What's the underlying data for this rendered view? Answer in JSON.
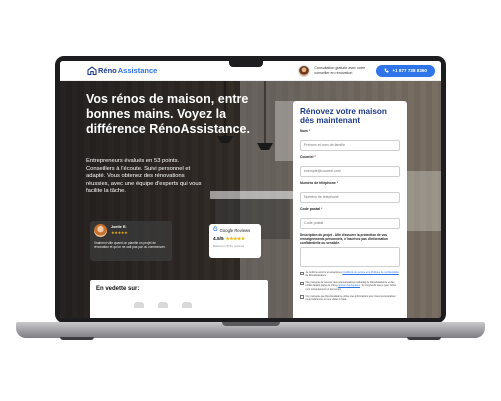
{
  "header": {
    "logo_reno": "Réno",
    "logo_assist": "Assistance",
    "consult_text": "Consultation gratuite avec notre conseiller en rénovation",
    "phone_label": "+1 877 738 8360"
  },
  "hero": {
    "headline": "Vos rénos de maison, entre bonnes mains. Voyez la différence RénoAssistance.",
    "subtext": "Entrepreneurs évalués en 53 points. Conseillers à l'écoute. Suivi personnel et adapté. Vous obtenez des rénovations réussies, avec une équipe d'experts qui vous facilite la tâche."
  },
  "testimonial": {
    "name": "Joelle R.",
    "stars": "★★★★★",
    "quote": "Vraiment ville quand on planifie un projet de rénovation et qu'on ne sait pas par où commencer."
  },
  "google_review": {
    "title": "Google Reviews",
    "score": "4.5/5",
    "stars": "★★★★★",
    "count": "Based on 870+ reviews"
  },
  "featured": {
    "title": "En vedette sur:"
  },
  "form": {
    "title": "Rénovez votre maison dès maintenant",
    "fields": [
      {
        "label": "Nom",
        "placeholder": "Prénom et nom de famille"
      },
      {
        "label": "Courriel",
        "placeholder": "exemple@courriel.com"
      },
      {
        "label": "Numéro de téléphone",
        "placeholder": "Numéro de téléphone"
      },
      {
        "label": "Code postal",
        "placeholder": "Code postal"
      }
    ],
    "required_mark": "*",
    "description_label": "Description du projet - Afin d'assurer la protection de vos renseignements personnels, n'inscrivez pas d'information confidentielle ou sensible.",
    "consents": [
      {
        "text": "Je confirme avoir lu et accepté les ",
        "link": "Conditions de service et la Politique de confidentialité",
        "after": " de RénoAssistance."
      },
      {
        "text": "Oui, j'accepte de recevoir des communications marketing de RénoAssistance et des entités faisant partie du même ",
        "link": "groupe d'entreprises",
        "after": ". Je comprends que je peux retirer mon consentement en tout temps."
      },
      {
        "text": "Oui, j'accepte que RénoAssistance utilise mes informations pour mieux personnaliser mes préférences et mes visites à l'aide",
        "link": "",
        "after": ""
      }
    ]
  }
}
